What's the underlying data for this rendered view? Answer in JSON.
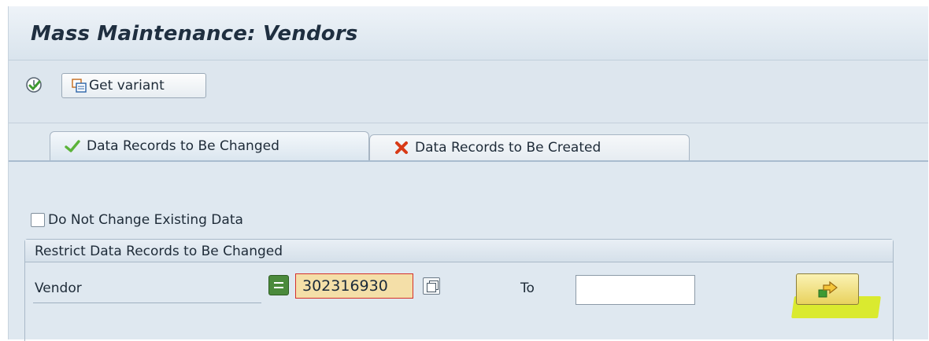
{
  "title": "Mass Maintenance: Vendors",
  "toolbar": {
    "get_variant_label": "Get variant"
  },
  "tabs": [
    {
      "label": "Data Records to Be Changed",
      "icon": "checkmark-icon",
      "active": true
    },
    {
      "label": "Data Records to Be Created",
      "icon": "x-icon",
      "active": false
    }
  ],
  "panel": {
    "checkbox_label": "Do Not Change Existing Data",
    "checkbox_checked": false,
    "group_title": "Restrict Data Records to Be Changed",
    "vendor_label": "Vendor",
    "vendor_value": "302316930",
    "to_label": "To",
    "to_value": ""
  },
  "colors": {
    "accent_highlight": "#d9ea1a",
    "field_highlight": "#f4dfa8",
    "field_border": "#d5302a",
    "select_option": "#4b8a3c"
  }
}
